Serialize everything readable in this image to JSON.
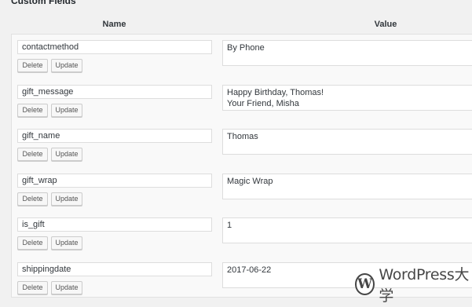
{
  "box_title": "Custom Fields",
  "columns": {
    "name": "Name",
    "value": "Value"
  },
  "buttons": {
    "delete": "Delete",
    "update": "Update"
  },
  "fields": [
    {
      "name": "contactmethod",
      "value": "By Phone"
    },
    {
      "name": "gift_message",
      "value": "Happy Birthday, Thomas!\nYour Friend, Misha"
    },
    {
      "name": "gift_name",
      "value": "Thomas"
    },
    {
      "name": "gift_wrap",
      "value": "Magic Wrap"
    },
    {
      "name": "is_gift",
      "value": "1"
    },
    {
      "name": "shippingdate",
      "value": "2017-06-22"
    }
  ],
  "watermark": {
    "text": "WordPress大学",
    "logo_letter": "W"
  }
}
